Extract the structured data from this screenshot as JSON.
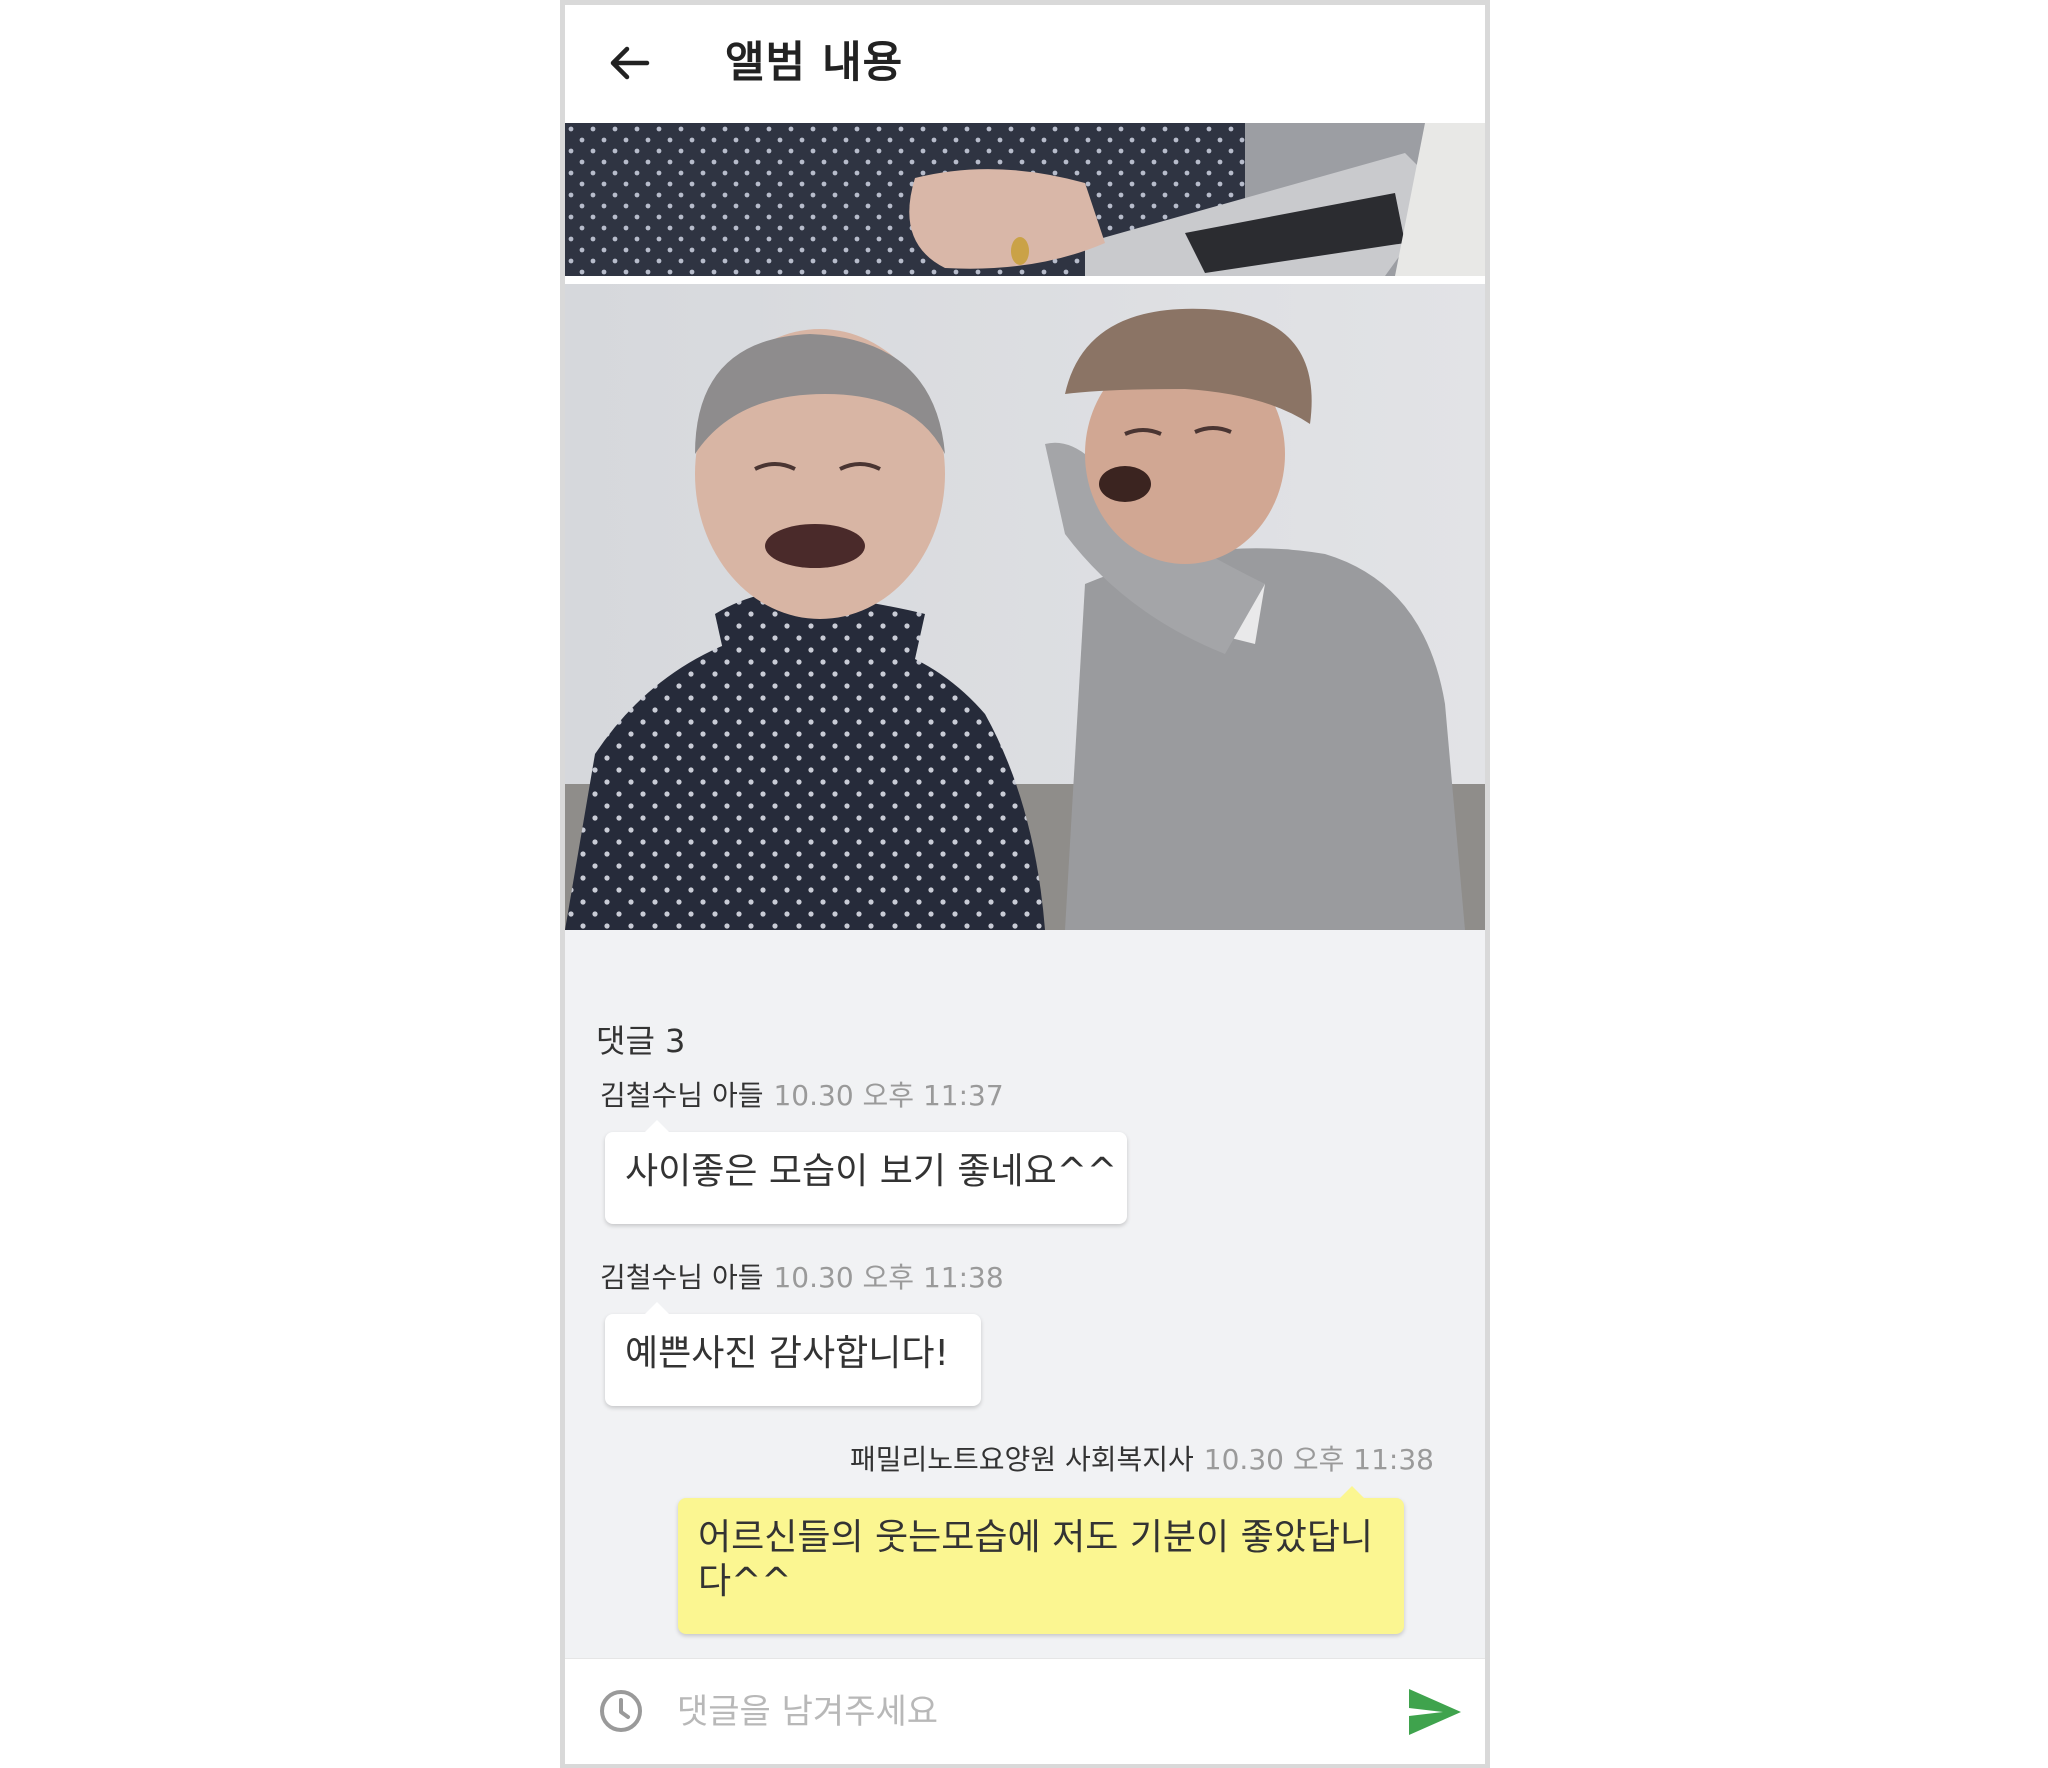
{
  "header": {
    "title": "앨범 내용",
    "back_icon": "arrow-left-icon"
  },
  "photos": [
    {
      "name": "album-photo-partial",
      "description_visible": false
    },
    {
      "name": "album-photo-main",
      "description_visible": false
    }
  ],
  "comments": {
    "count_label": "댓글 3",
    "items": [
      {
        "author": "김철수님 아들",
        "time": "10.30 오후 11:37",
        "text": "사이좋은 모습이 보기 좋네요^^",
        "mine": false
      },
      {
        "author": "김철수님 아들",
        "time": "10.30 오후 11:38",
        "text": "예쁜사진 감사합니다!",
        "mine": false
      },
      {
        "author": "패밀리노트요양원 사회복지사",
        "time": "10.30 오후 11:38",
        "text": "어르신들의 웃는모습에 저도 기분이 좋았답니다^^",
        "mine": true
      }
    ]
  },
  "input": {
    "placeholder": "댓글을 남겨주세요",
    "value": "",
    "left_icon": "clock-icon",
    "send_icon": "send-icon"
  },
  "colors": {
    "mine_bubble": "#fbf691",
    "send_accent": "#3fa34d",
    "background": "#f1f2f4"
  }
}
